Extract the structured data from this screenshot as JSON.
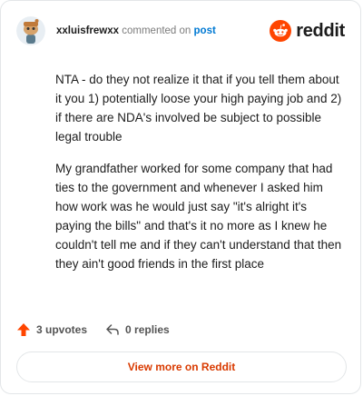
{
  "comment": {
    "username": "xxluisfrewxx",
    "action_text": "commented on",
    "post_link": "post",
    "paragraphs": [
      "NTA - do they not realize it that if you tell them about it you 1) potentially loose your high paying job and 2) if there are NDA's involved be subject to possible legal trouble",
      "My grandfather worked for some company that had ties to the government and whenever I asked him how work was he would just say \"it's alright it's paying the bills\" and that's it no more as I knew he couldn't tell me and if they can't understand that then they ain't good friends in the first place"
    ],
    "upvotes_label": "3 upvotes",
    "replies_label": "0 replies"
  },
  "brand": {
    "wordmark": "reddit"
  },
  "cta": {
    "label": "View more on Reddit"
  },
  "colors": {
    "brand_orange": "#ff4500",
    "link_blue": "#0079d3",
    "cta_text": "#d93a00"
  },
  "icons": {
    "avatar": "snoo-avatar-icon",
    "logo": "reddit-logo-icon",
    "upvote": "upvote-arrow-icon",
    "reply": "reply-arrow-icon"
  }
}
